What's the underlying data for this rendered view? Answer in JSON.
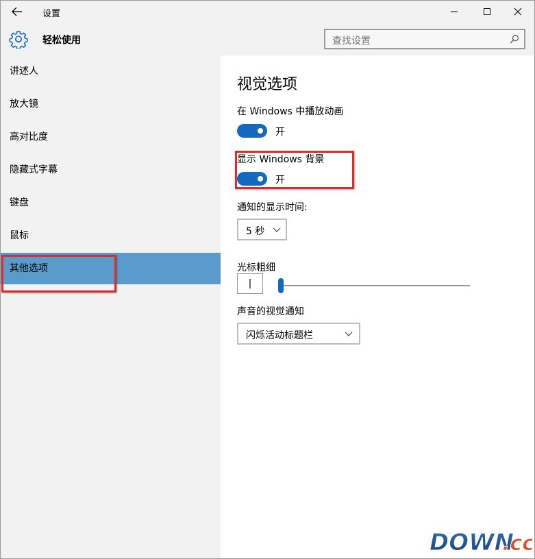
{
  "window": {
    "title": "设置"
  },
  "header": {
    "title": "轻松使用",
    "search_placeholder": "查找设置"
  },
  "sidebar": {
    "items": [
      {
        "label": "讲述人",
        "active": false
      },
      {
        "label": "放大镜",
        "active": false
      },
      {
        "label": "高对比度",
        "active": false
      },
      {
        "label": "隐藏式字幕",
        "active": false
      },
      {
        "label": "键盘",
        "active": false
      },
      {
        "label": "鼠标",
        "active": false
      },
      {
        "label": "其他选项",
        "active": true
      }
    ]
  },
  "main": {
    "title": "视觉选项",
    "animation": {
      "label": "在 Windows 中播放动画",
      "state": "开"
    },
    "background": {
      "label": "显示 Windows 背景",
      "state": "开"
    },
    "notification": {
      "label": "通知的显示时间:",
      "value": "5 秒"
    },
    "cursor": {
      "label": "光标粗细",
      "preview": "|",
      "level": 0
    },
    "sound": {
      "label": "声音的视觉通知",
      "value": "闪烁活动标题栏"
    }
  },
  "watermark": {
    "main": "DOWN",
    "suffix": ".cc"
  },
  "colors": {
    "accent": "#1368c0",
    "selected_nav": "#5b9bcb",
    "highlight": "#e12a2a"
  }
}
